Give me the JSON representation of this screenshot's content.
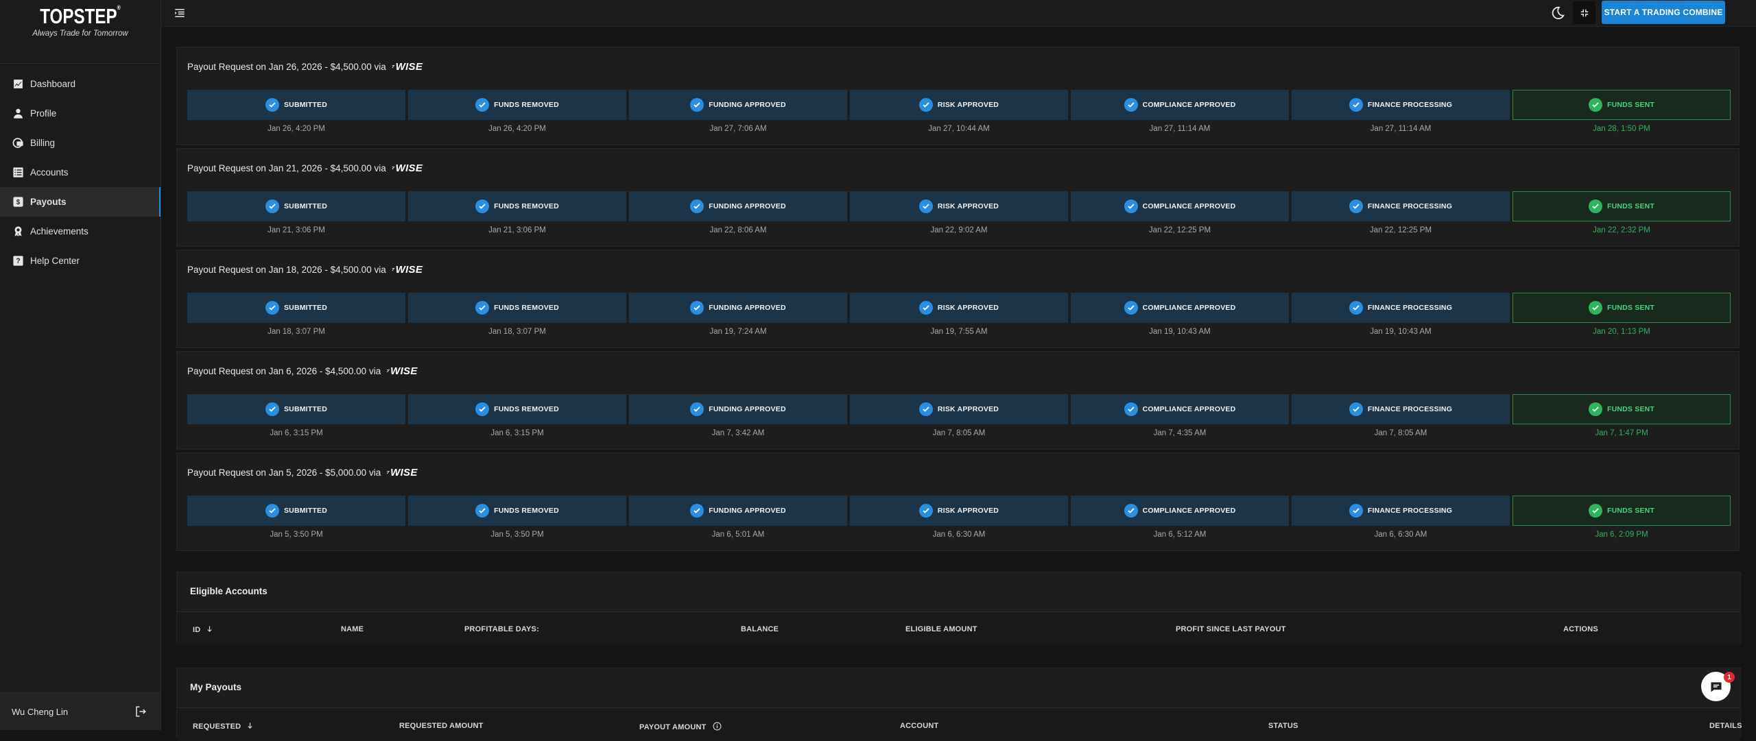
{
  "brand": {
    "logo": "TOPSTEP",
    "tagline": "Always Trade for Tomorrow"
  },
  "nav": [
    {
      "label": "Dashboard",
      "icon": "chart-icon"
    },
    {
      "label": "Profile",
      "icon": "person-icon"
    },
    {
      "label": "Billing",
      "icon": "billing-icon"
    },
    {
      "label": "Accounts",
      "icon": "list-icon"
    },
    {
      "label": "Payouts",
      "icon": "dollar-icon",
      "active": true
    },
    {
      "label": "Achievements",
      "icon": "award-icon"
    },
    {
      "label": "Help Center",
      "icon": "help-icon"
    }
  ],
  "user": {
    "name": "Wu Cheng Lin"
  },
  "topbar": {
    "start_button": "START A TRADING COMBINE"
  },
  "step_labels": [
    "SUBMITTED",
    "FUNDS REMOVED",
    "FUNDING APPROVED",
    "RISK APPROVED",
    "COMPLIANCE APPROVED",
    "FINANCE PROCESSING",
    "FUNDS SENT"
  ],
  "payouts": [
    {
      "title": "Payout Request on Jan 26, 2026 - $4,500.00 via",
      "method": "WISE",
      "times": [
        "Jan 26, 4:20 PM",
        "Jan 26, 4:20 PM",
        "Jan 27, 7:06 AM",
        "Jan 27, 10:44 AM",
        "Jan 27, 11:14 AM",
        "Jan 27, 11:14 AM",
        "Jan 28, 1:50 PM"
      ]
    },
    {
      "title": "Payout Request on Jan 21, 2026 - $4,500.00 via",
      "method": "WISE",
      "times": [
        "Jan 21, 3:06 PM",
        "Jan 21, 3:06 PM",
        "Jan 22, 8:06 AM",
        "Jan 22, 9:02 AM",
        "Jan 22, 12:25 PM",
        "Jan 22, 12:25 PM",
        "Jan 22, 2:32 PM"
      ]
    },
    {
      "title": "Payout Request on Jan 18, 2026 - $4,500.00 via",
      "method": "WISE",
      "times": [
        "Jan 18, 3:07 PM",
        "Jan 18, 3:07 PM",
        "Jan 19, 7:24 AM",
        "Jan 19, 7:55 AM",
        "Jan 19, 10:43 AM",
        "Jan 19, 10:43 AM",
        "Jan 20, 1:13 PM"
      ]
    },
    {
      "title": "Payout Request on Jan 6, 2026 - $4,500.00 via",
      "method": "WISE",
      "times": [
        "Jan 6, 3:15 PM",
        "Jan 6, 3:15 PM",
        "Jan 7, 3:42 AM",
        "Jan 7, 8:05 AM",
        "Jan 7, 4:35 AM",
        "Jan 7, 8:05 AM",
        "Jan 7, 1:47 PM"
      ]
    },
    {
      "title": "Payout Request on Jan 5, 2026 - $5,000.00 via",
      "method": "WISE",
      "times": [
        "Jan 5, 3:50 PM",
        "Jan 5, 3:50 PM",
        "Jan 6, 5:01 AM",
        "Jan 6, 6:30 AM",
        "Jan 6, 5:12 AM",
        "Jan 6, 6:30 AM",
        "Jan 6, 2:09 PM"
      ]
    }
  ],
  "eligible": {
    "title": "Eligible Accounts",
    "columns": [
      "ID",
      "NAME",
      "PROFITABLE DAYS:",
      "BALANCE",
      "ELIGIBLE AMOUNT",
      "PROFIT SINCE LAST PAYOUT",
      "ACTIONS"
    ]
  },
  "my_payouts": {
    "title": "My Payouts",
    "columns": [
      "REQUESTED",
      "REQUESTED AMOUNT",
      "PAYOUT AMOUNT",
      "ACCOUNT",
      "STATUS",
      "DETAILS"
    ]
  },
  "chat": {
    "badge_count": "1"
  },
  "colors": {
    "accent": "#1a84d6",
    "step_bg": "#1c3448",
    "success": "#2fb55f"
  }
}
